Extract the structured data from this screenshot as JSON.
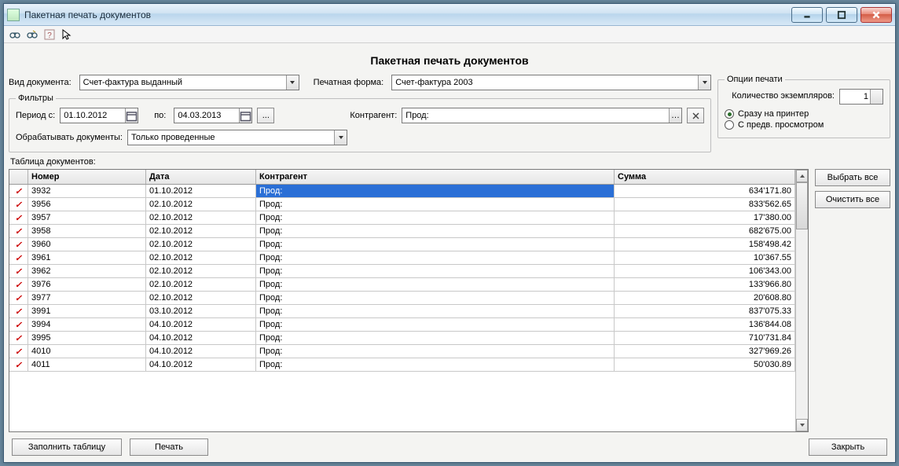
{
  "window": {
    "title": "Пакетная печать документов"
  },
  "page_title": "Пакетная печать документов",
  "doc_type": {
    "label": "Вид документа:",
    "value": "Счет-фактура выданный"
  },
  "print_form": {
    "label": "Печатная форма:",
    "value": "Счет-фактура 2003"
  },
  "filters": {
    "legend": "Фильтры",
    "period_from_label": "Период с:",
    "period_from": "01.10.2012",
    "period_to_label": "по:",
    "period_to": "04.03.2013",
    "ellipsis": "...",
    "contractor_label": "Контрагент:",
    "contractor_value": "Прод:",
    "process_label": "Обрабатывать документы:",
    "process_value": "Только проведенные"
  },
  "print_opts": {
    "legend": "Опции печати",
    "copies_label": "Количество экземпляров:",
    "copies_value": "1",
    "radio_printer": "Сразу на принтер",
    "radio_preview": "С предв. просмотром",
    "selected": "printer"
  },
  "table": {
    "label": "Таблица документов:",
    "columns": {
      "number": "Номер",
      "date": "Дата",
      "contractor": "Контрагент",
      "sum": "Сумма"
    },
    "rows": [
      {
        "n": "3932",
        "d": "01.10.2012",
        "c": "Прод:",
        "s": "634'171.80",
        "sel": true
      },
      {
        "n": "3956",
        "d": "02.10.2012",
        "c": "Прод:",
        "s": "833'562.65"
      },
      {
        "n": "3957",
        "d": "02.10.2012",
        "c": "Прод:",
        "s": "17'380.00"
      },
      {
        "n": "3958",
        "d": "02.10.2012",
        "c": "Прод:",
        "s": "682'675.00"
      },
      {
        "n": "3960",
        "d": "02.10.2012",
        "c": "Прод:",
        "s": "158'498.42"
      },
      {
        "n": "3961",
        "d": "02.10.2012",
        "c": "Прод:",
        "s": "10'367.55"
      },
      {
        "n": "3962",
        "d": "02.10.2012",
        "c": "Прод:",
        "s": "106'343.00"
      },
      {
        "n": "3976",
        "d": "02.10.2012",
        "c": "Прод:",
        "s": "133'966.80"
      },
      {
        "n": "3977",
        "d": "02.10.2012",
        "c": "Прод:",
        "s": "20'608.80"
      },
      {
        "n": "3991",
        "d": "03.10.2012",
        "c": "Прод:",
        "s": "837'075.33"
      },
      {
        "n": "3994",
        "d": "04.10.2012",
        "c": "Прод:",
        "s": "136'844.08"
      },
      {
        "n": "3995",
        "d": "04.10.2012",
        "c": "Прод:",
        "s": "710'731.84"
      },
      {
        "n": "4010",
        "d": "04.10.2012",
        "c": "Прод:",
        "s": "327'969.26"
      },
      {
        "n": "4011",
        "d": "04.10.2012",
        "c": "Прод:",
        "s": "50'030.89"
      }
    ]
  },
  "buttons": {
    "select_all": "Выбрать все",
    "clear_all": "Очистить все",
    "fill_table": "Заполнить таблицу",
    "print": "Печать",
    "close": "Закрыть"
  }
}
